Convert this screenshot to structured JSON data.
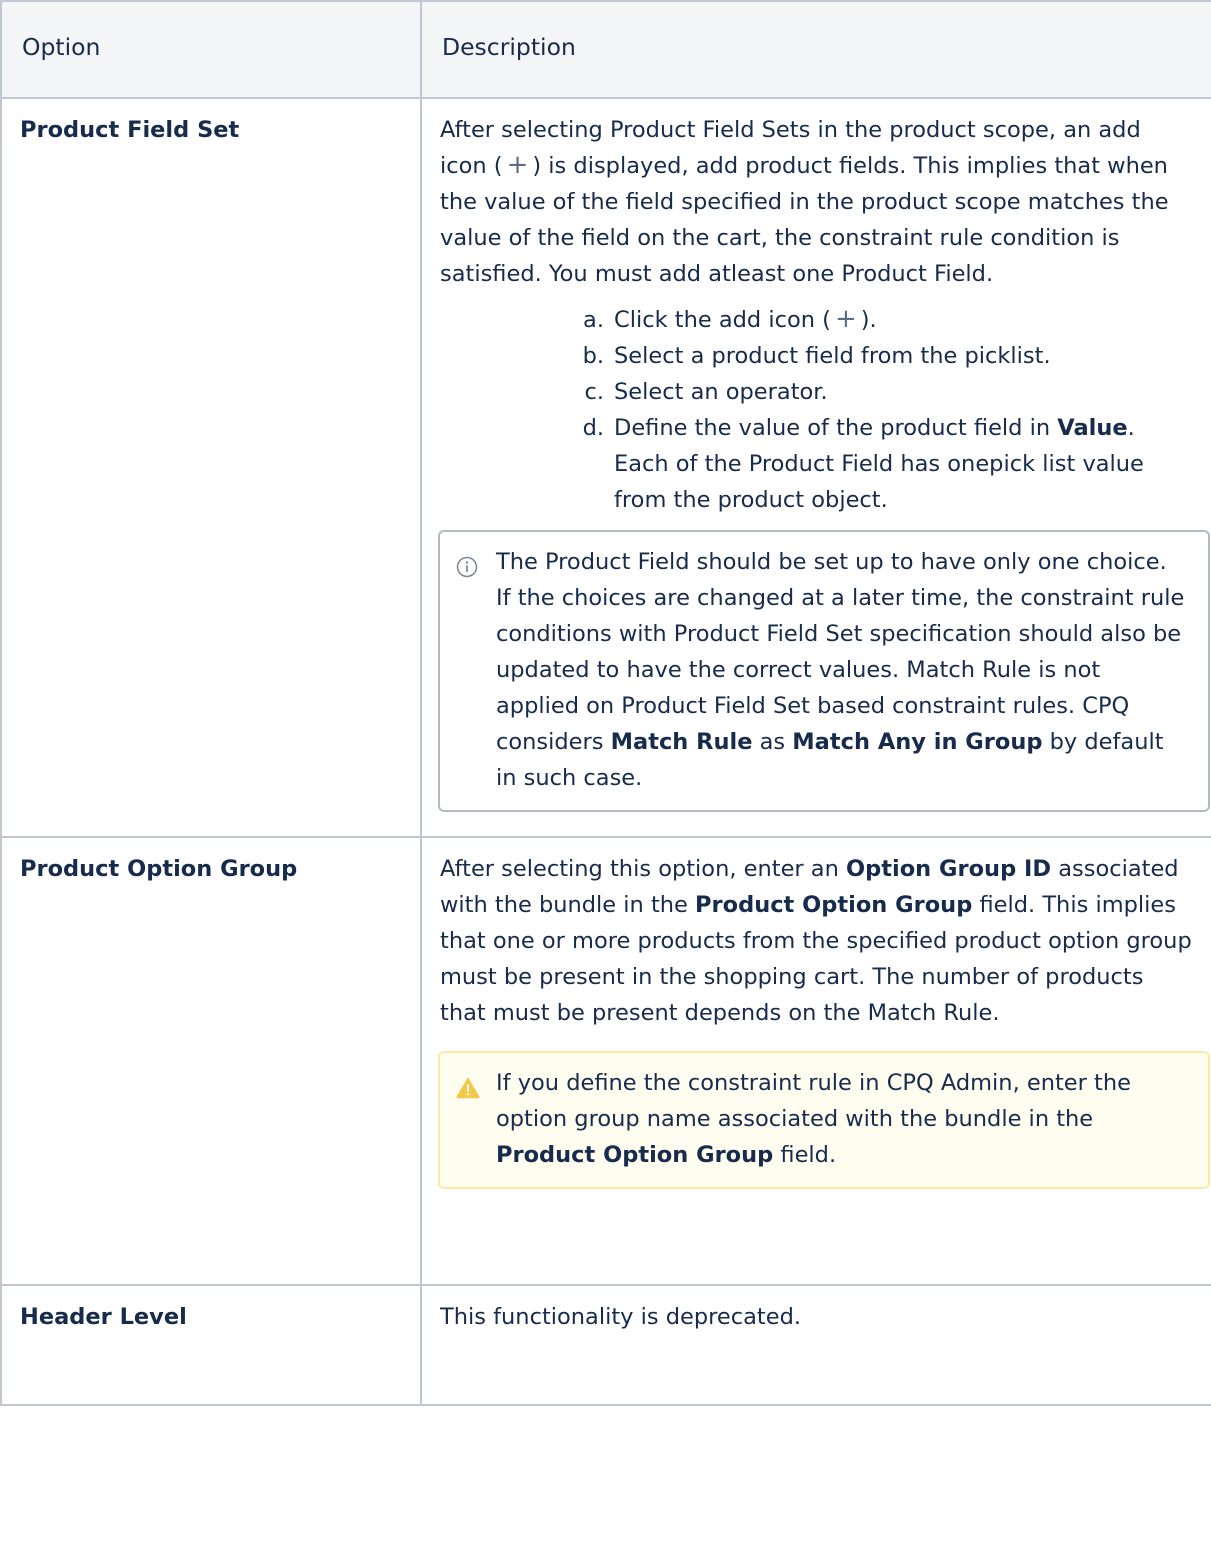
{
  "table": {
    "headers": [
      "Option",
      "Description"
    ],
    "rows": {
      "product_field_set": {
        "option": "Product Field Set",
        "desc_1": "After selecting Product Field Sets in the product scope, an add icon (",
        "desc_2": ") is displayed, add product fields. This implies that when the value of the field specified in the product scope matches the value of the field on the cart, the constraint rule condition is satisfied. You must add atleast one Product Field.",
        "steps": [
          {
            "letter": "a.",
            "pre": "Click the add icon (",
            "post": ")."
          },
          {
            "letter": "b.",
            "text": "Select a product field from the picklist."
          },
          {
            "letter": "c.",
            "text": "Select an operator."
          },
          {
            "letter": "d.",
            "pre": "Define the value of the product field in ",
            "bold": "Value",
            "post": ". Each of the Product Field has onepick list value from the product object."
          }
        ],
        "info_note": {
          "text_1": "The Product Field should be set up to have only one choice. If the choices are changed at a later time, the constraint rule conditions with Product Field Set specification should also be updated to have the correct values. Match Rule is not applied on Product Field Set based constraint rules. CPQ considers ",
          "bold_1": "Match Rule",
          "text_2": " as ",
          "bold_2": "Match Any in Group",
          "text_3": " by default in such case."
        }
      },
      "product_option_group": {
        "option": "Product Option Group",
        "text_1": "After selecting this option, enter an ",
        "bold_1": "Option Group ID",
        "text_2": " associated with the bundle in the ",
        "bold_2": "Product Option Group",
        "text_3": " field. This implies that one or more products from the specified product option group must be present in the shopping cart. The number of products that must be present depends on the Match Rule.",
        "warning_note": {
          "text_1": "If you define the constraint rule in CPQ Admin, enter the option group name associated with the bundle in the ",
          "bold_1": "Product Option Group",
          "text_2": " field."
        }
      },
      "header_level": {
        "option": "Header Level",
        "description": "This functionality is deprecated."
      }
    }
  },
  "icons": {
    "add": "plus-icon",
    "info": "info-icon",
    "warning": "warning-icon"
  },
  "colors": {
    "text": "#172b4d",
    "border": "#c1c7d0",
    "header_bg": "#f4f5f7",
    "warning_accent": "#f2c94c",
    "warning_border": "#ffe8a0"
  }
}
